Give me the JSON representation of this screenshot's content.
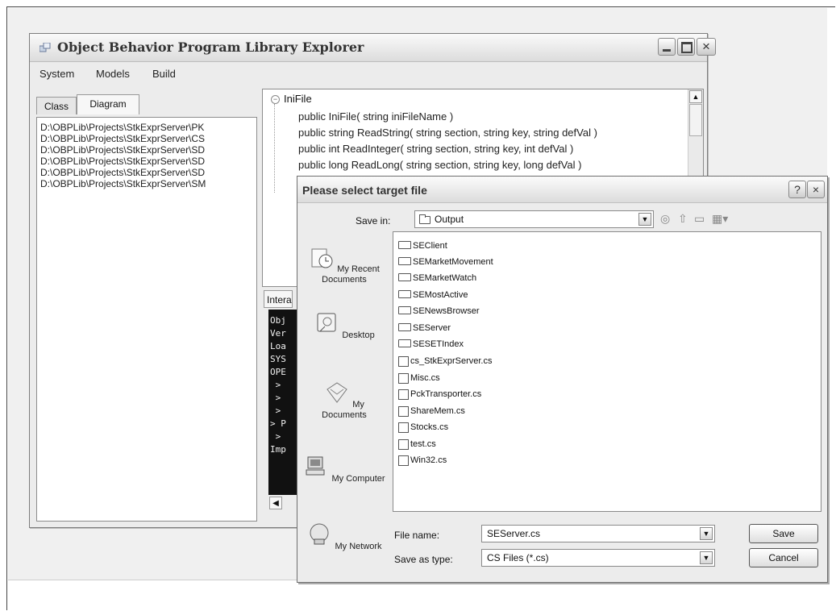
{
  "main_window": {
    "title": "Object Behavior Program Library Explorer",
    "menu": [
      "System",
      "Models",
      "Build"
    ],
    "tabs": [
      "Class",
      "Diagram"
    ],
    "active_tab": "Diagram",
    "path_list": [
      "D:\\OBPLib\\Projects\\StkExprServer\\PK",
      "D:\\OBPLib\\Projects\\StkExprServer\\CS",
      "D:\\OBPLib\\Projects\\StkExprServer\\SD",
      "D:\\OBPLib\\Projects\\StkExprServer\\SD",
      "D:\\OBPLib\\Projects\\StkExprServer\\SD",
      "D:\\OBPLib\\Projects\\StkExprServer\\SM"
    ],
    "tree": {
      "root": "IniFile",
      "items": [
        "public IniFile( string iniFileName )",
        "public string ReadString( string section, string key, string defVal )",
        "public int ReadInteger( string section, string key, int defVal )",
        "public long ReadLong( string section, string key, long defVal )"
      ]
    },
    "interact_tab": "Intera",
    "console_lines": [
      "Obj",
      "Ver",
      "Loa",
      "SYS",
      "OPE",
      " >",
      " >",
      " >",
      "> P",
      " >",
      "Imp"
    ]
  },
  "dialog": {
    "title": "Please select target file",
    "save_in_label": "Save in:",
    "save_in_value": "Output",
    "places": [
      "My Recent Documents",
      "Desktop",
      "My Documents",
      "My Computer",
      "My Network"
    ],
    "files": [
      {
        "name": "SEClient",
        "type": "folder"
      },
      {
        "name": "SEMarketMovement",
        "type": "folder"
      },
      {
        "name": "SEMarketWatch",
        "type": "folder"
      },
      {
        "name": "SEMostActive",
        "type": "folder"
      },
      {
        "name": "SENewsBrowser",
        "type": "folder"
      },
      {
        "name": "SEServer",
        "type": "folder"
      },
      {
        "name": "SESETIndex",
        "type": "folder"
      },
      {
        "name": "cs_StkExprServer.cs",
        "type": "file"
      },
      {
        "name": "Misc.cs",
        "type": "file"
      },
      {
        "name": "PckTransporter.cs",
        "type": "file"
      },
      {
        "name": "ShareMem.cs",
        "type": "file"
      },
      {
        "name": "Stocks.cs",
        "type": "file"
      },
      {
        "name": "test.cs",
        "type": "file"
      },
      {
        "name": "Win32.cs",
        "type": "file"
      }
    ],
    "file_name_label": "File name:",
    "file_name_value": "SEServer.cs",
    "save_type_label": "Save as type:",
    "save_type_value": "CS Files (*.cs)",
    "save_button": "Save",
    "cancel_button": "Cancel"
  }
}
